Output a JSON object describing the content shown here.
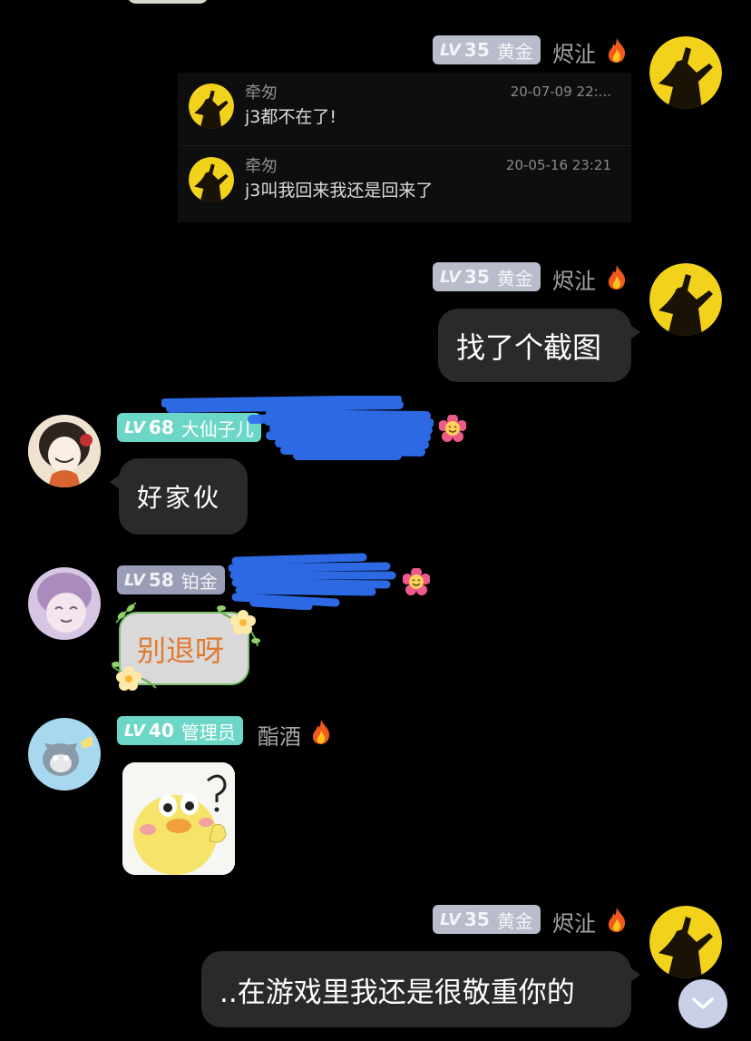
{
  "messages": [
    {
      "sender": "烬沚",
      "level_prefix": "LV",
      "level": "35",
      "title": "黄金",
      "quotes": [
        {
          "name": "牵匆",
          "time": "20-07-09 22:...",
          "text": "j3都不在了!"
        },
        {
          "name": "牵匆",
          "time": "20-05-16 23:21",
          "text": "j3叫我回来我还是回来了"
        }
      ]
    },
    {
      "sender": "烬沚",
      "level_prefix": "LV",
      "level": "35",
      "title": "黄金",
      "text": "找了个截图"
    },
    {
      "sender": "",
      "level_prefix": "LV",
      "level": "68",
      "title": "大仙子儿",
      "text": "好家伙"
    },
    {
      "sender": "",
      "level_prefix": "LV",
      "level": "58",
      "title": "铂金",
      "text": "别退呀"
    },
    {
      "sender": "酯酒",
      "level_prefix": "LV",
      "level": "40",
      "title": "管理员",
      "sticker": "yellow-duck-sticker"
    },
    {
      "sender": "烬沚",
      "level_prefix": "LV",
      "level": "35",
      "title": "黄金",
      "text": "..在游戏里我还是很敬重你的"
    }
  ],
  "colors": {
    "bubble": "#2a2a2a",
    "gold_badge": "#b8bccb",
    "teal_badge": "#6cd7c7",
    "plat_badge": "#9a9db6",
    "orange_text": "#e07a30"
  },
  "icons": {
    "fire": "fire-icon",
    "scroll_down": "chevron-down-icon"
  }
}
